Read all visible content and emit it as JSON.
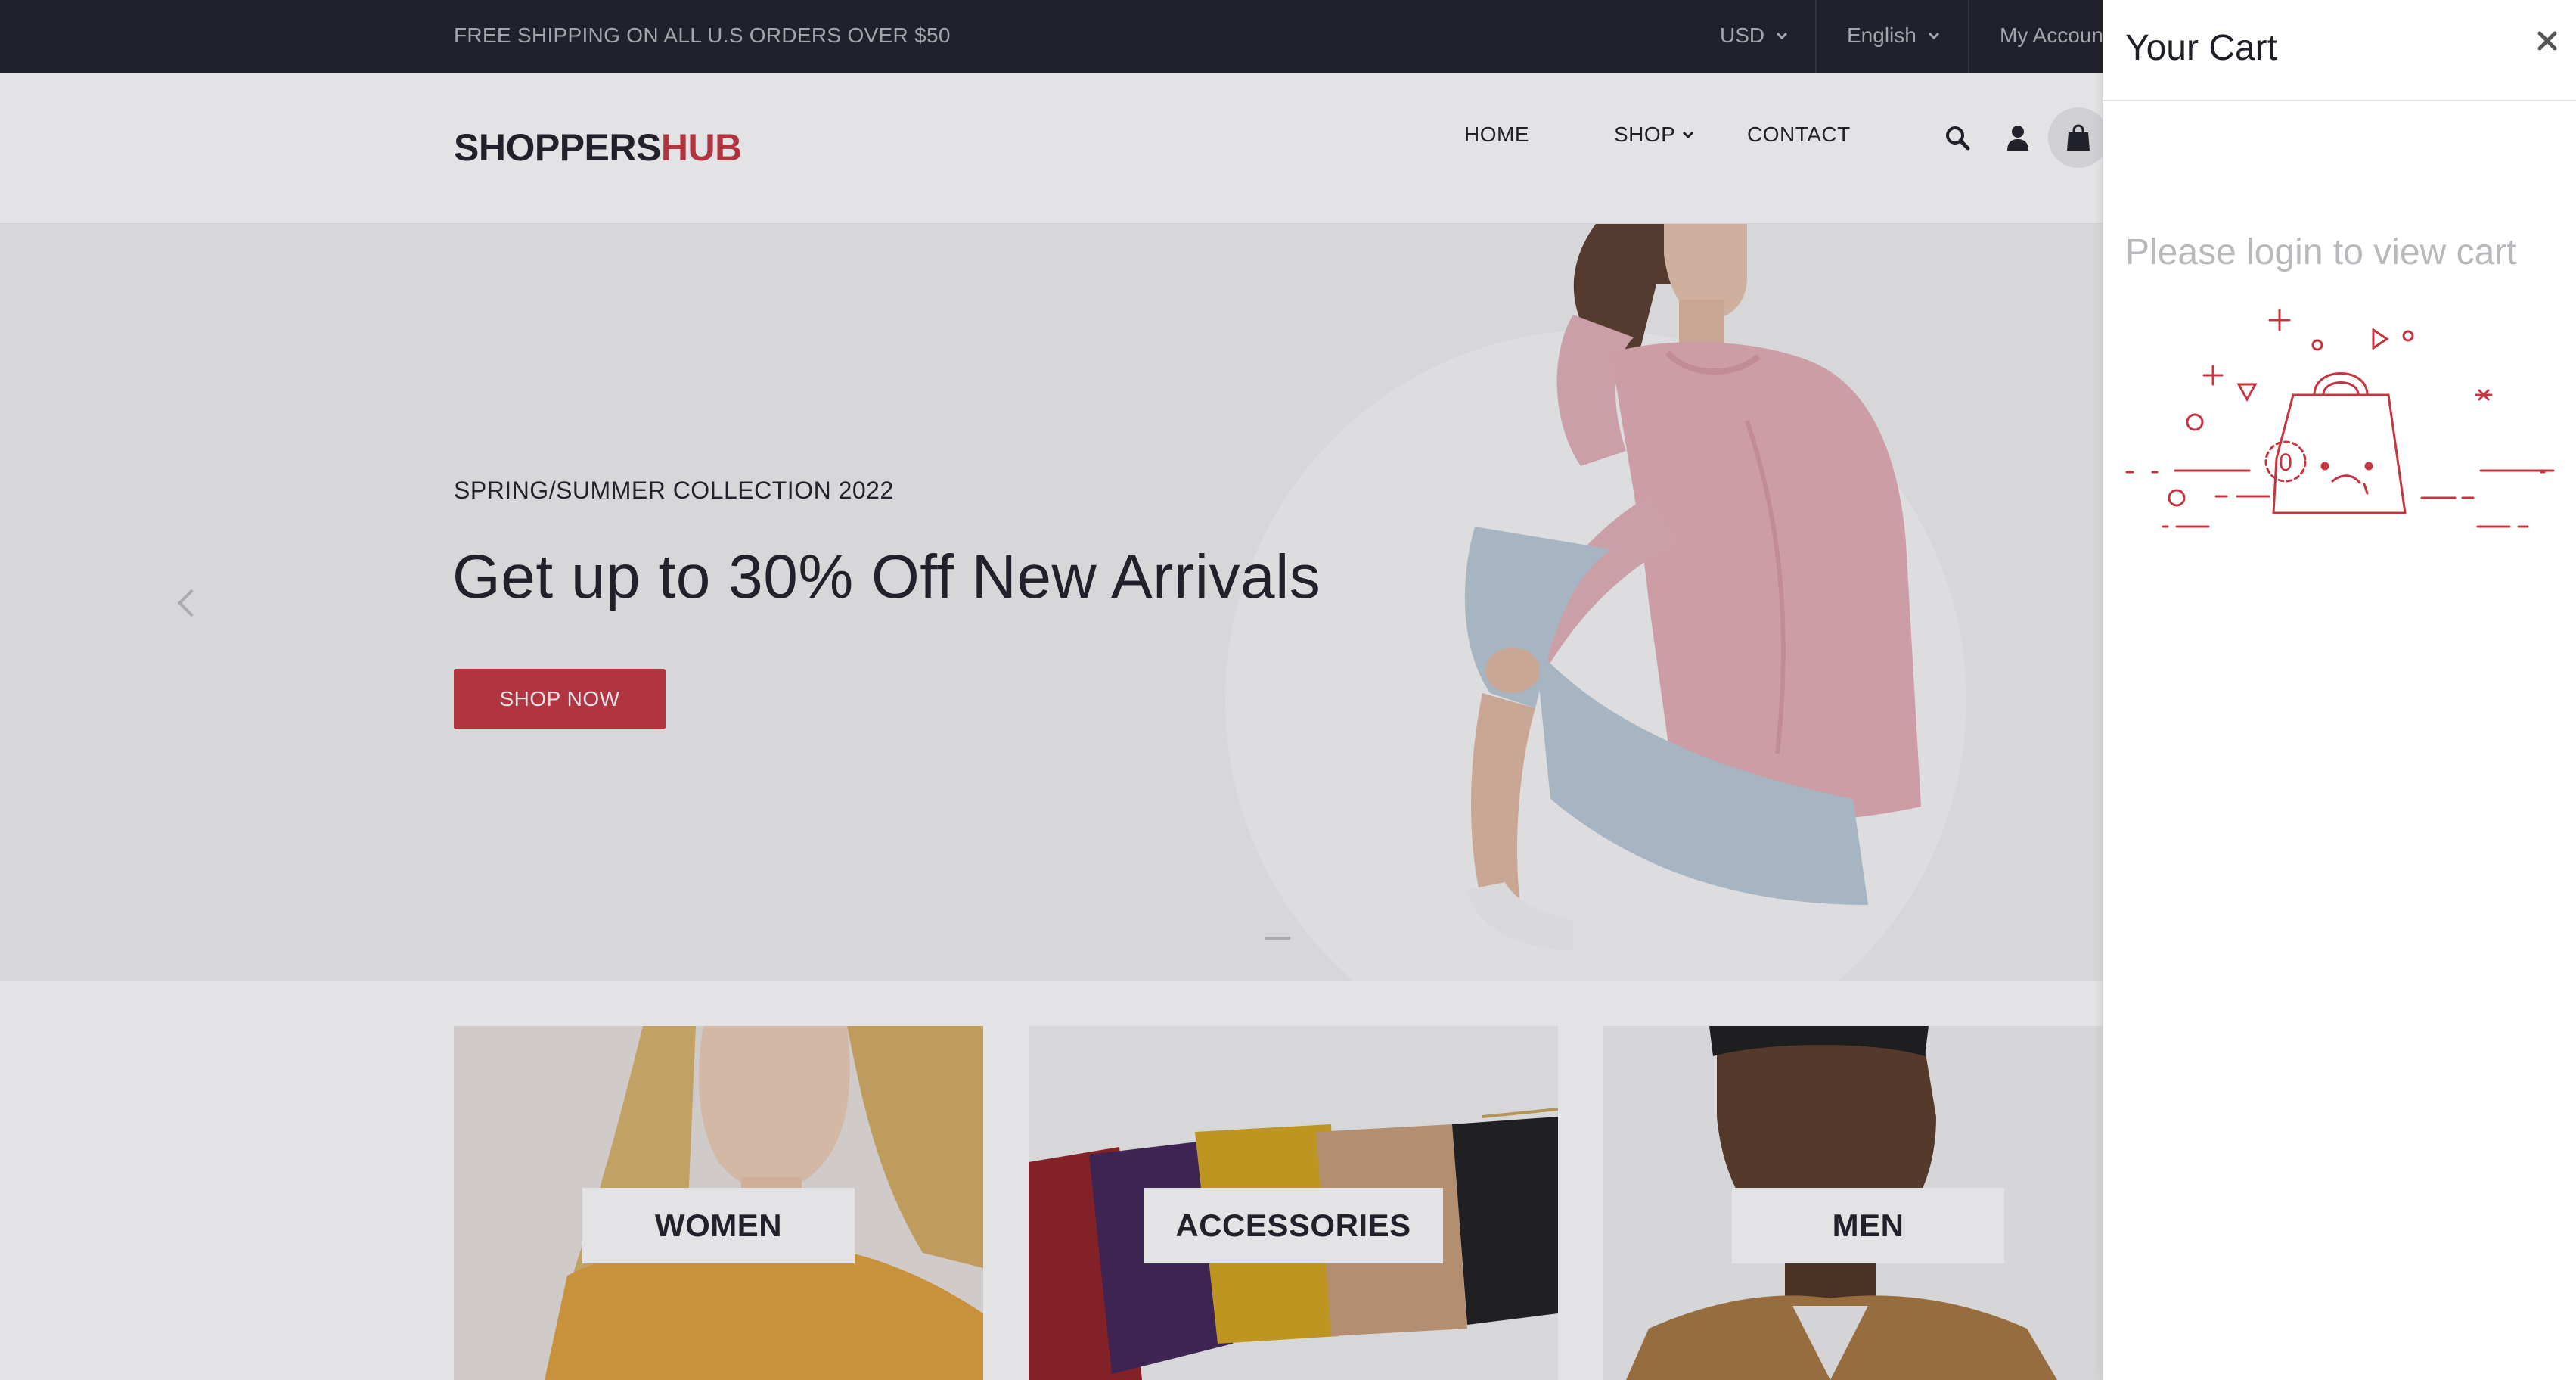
{
  "topbar": {
    "promo": "FREE SHIPPING ON ALL U.S ORDERS OVER $50",
    "currency": "USD",
    "language": "English",
    "account": "My Account"
  },
  "header": {
    "logo_part1": "SHOPPERS",
    "logo_part2": "HUB",
    "nav": {
      "home": "HOME",
      "shop": "SHOP",
      "contact": "CONTACT"
    },
    "icons": [
      "search-icon",
      "user-icon",
      "shopping-bag-icon"
    ]
  },
  "hero": {
    "subtitle": "SPRING/SUMMER COLLECTION 2022",
    "title": "Get up to 30% Off New Arrivals",
    "button": "SHOP NOW"
  },
  "categories": {
    "women": "WOMEN",
    "accessories": "ACCESSORIES",
    "men": "MEN"
  },
  "cart": {
    "title": "Your Cart",
    "message": "Please login to view cart",
    "count": "0"
  },
  "colors": {
    "accent": "#c4353f",
    "dark": "#1e1e27",
    "topbar_text": "#b5b6bd",
    "muted": "#b8b8bd"
  }
}
